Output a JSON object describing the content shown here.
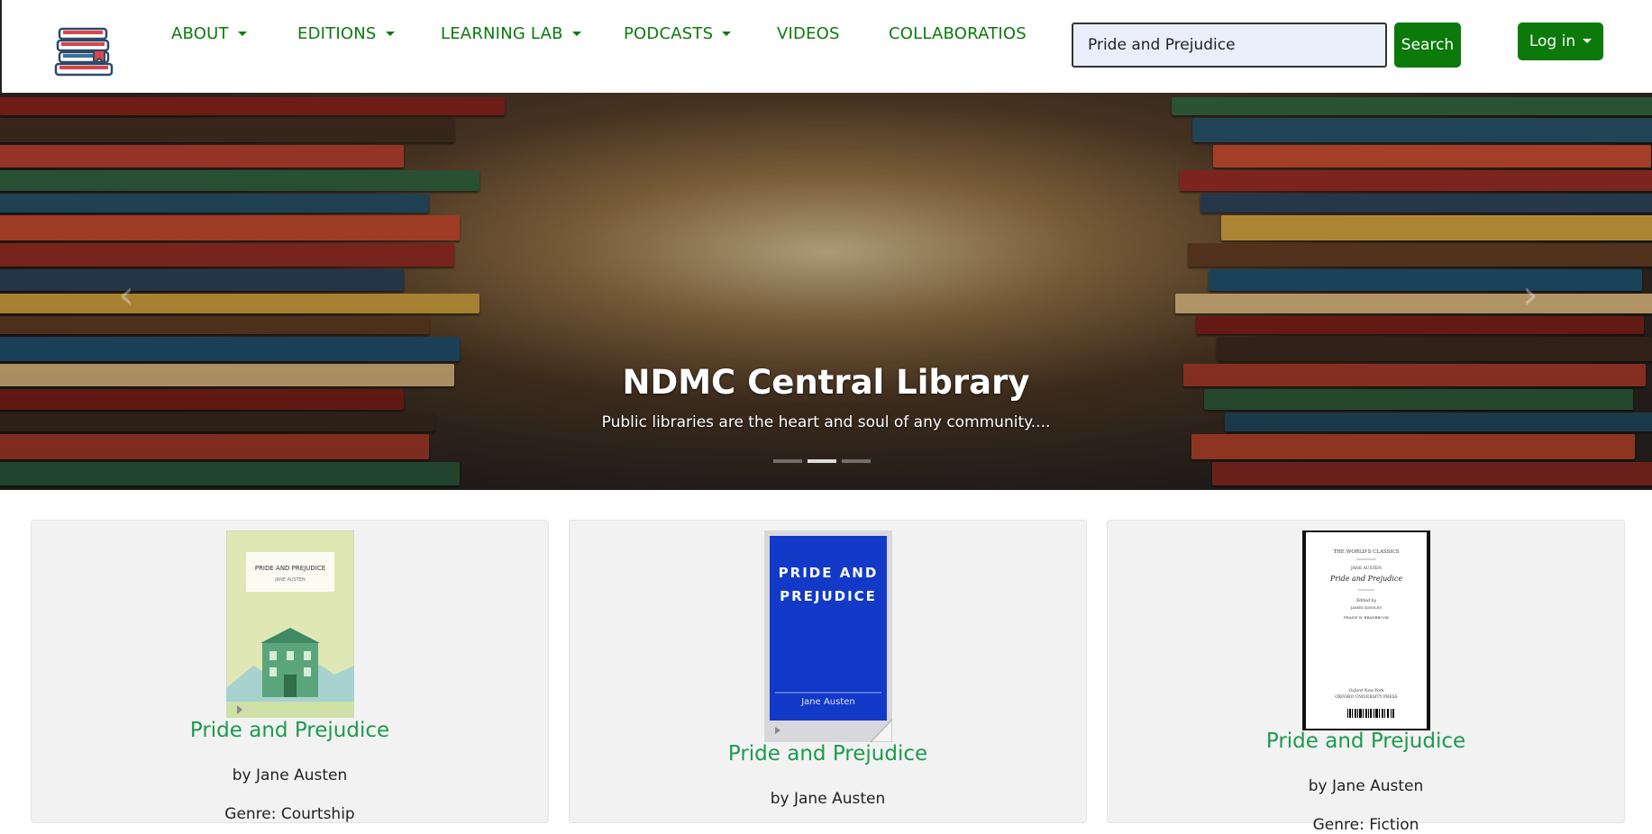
{
  "nav": {
    "items": [
      {
        "label": "ABOUT",
        "dropdown": true
      },
      {
        "label": "EDITIONS",
        "dropdown": true
      },
      {
        "label": "LEARNING LAB",
        "dropdown": true
      },
      {
        "label": "PODCASTS",
        "dropdown": true
      },
      {
        "label": "VIDEOS",
        "dropdown": false
      },
      {
        "label": "COLLABORATIOS",
        "dropdown": false
      }
    ],
    "search": {
      "value": "Pride and Prejudice",
      "button_label": "Search"
    },
    "login_label": "Log in"
  },
  "hero": {
    "title": "NDMC Central Library",
    "subtitle": "Public libraries are the heart and soul of any community....",
    "slides": 3,
    "active_slide": 1
  },
  "results": [
    {
      "title": "Pride and Prejudice",
      "author": "by Jane Austen",
      "genre": "Genre: Courtship",
      "cover_title": "PRIDE AND PREJUDICE",
      "cover_author": "JANE AUSTEN"
    },
    {
      "title": "Pride and Prejudice",
      "author": "by Jane Austen",
      "genre": "",
      "cover_title_1": "PRIDE AND",
      "cover_title_2": "PREJUDICE",
      "cover_author": "Jane Austen"
    },
    {
      "title": "Pride and Prejudice",
      "author": "by Jane Austen",
      "genre": "Genre: Fiction",
      "cover_series": "THE WORLD'S CLASSICS",
      "cover_author": "JANE AUSTEN",
      "cover_title": "Pride and Prejudice",
      "cover_edited": "Edited by",
      "cover_editor_1": "JAMES KINSLEY",
      "cover_editor_2": "FRANK W. BRADBROOK",
      "cover_publisher_city": "Oxford  New York",
      "cover_publisher": "OXFORD UNIVERSITY PRESS"
    }
  ],
  "colors": {
    "brand_green": "#0b7a0b",
    "title_green": "#1c9a4f"
  }
}
